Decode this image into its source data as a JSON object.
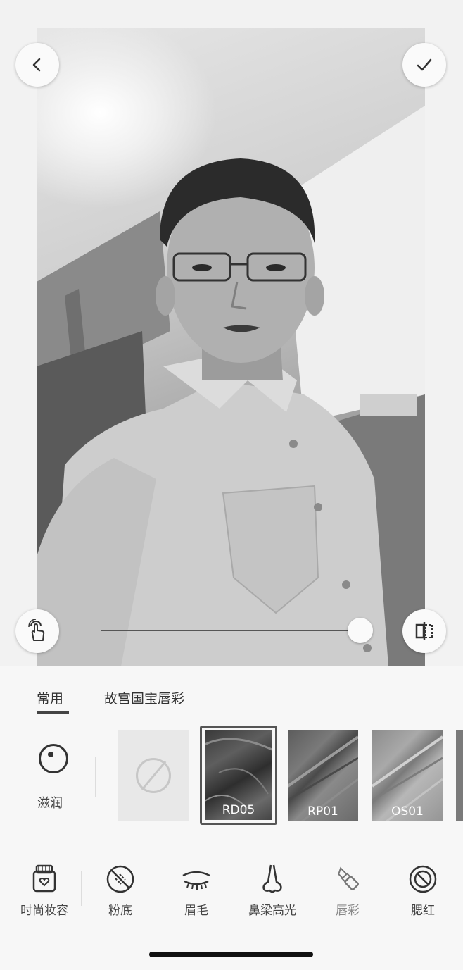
{
  "toolbar": {
    "back_icon": "chevron-left-icon",
    "confirm_icon": "checkmark-icon",
    "touch_icon": "hand-touch-icon",
    "compare_icon": "compare-split-icon"
  },
  "slider": {
    "value": 1.0
  },
  "tabs": [
    {
      "label": "常用",
      "active": true
    },
    {
      "label": "故宫国宝唇彩",
      "active": false
    }
  ],
  "finish": {
    "icon": "moisture-icon",
    "label": "滋润"
  },
  "swatches": [
    {
      "label": "",
      "icon": "none-icon"
    },
    {
      "label": "RD05",
      "selected": true
    },
    {
      "label": "RP01"
    },
    {
      "label": "OS01"
    }
  ],
  "nav": [
    {
      "label": "时尚妆容",
      "icon": "makeup-kit-icon"
    },
    {
      "label": "粉底",
      "icon": "foundation-icon"
    },
    {
      "label": "眉毛",
      "icon": "eyebrow-icon"
    },
    {
      "label": "鼻梁高光",
      "icon": "nose-icon"
    },
    {
      "label": "唇彩",
      "icon": "lipstick-icon",
      "active": true
    },
    {
      "label": "腮红",
      "icon": "blush-icon"
    }
  ]
}
